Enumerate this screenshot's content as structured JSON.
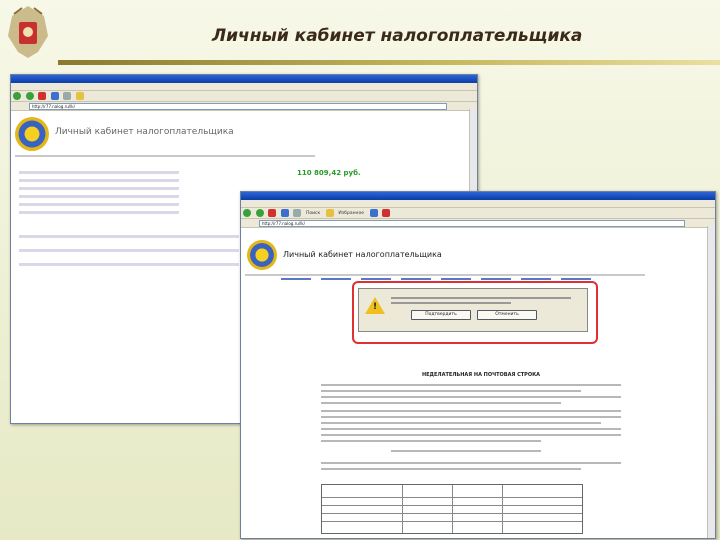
{
  "slide": {
    "title": "Личный кабинет налогоплательщика",
    "accent": "#3b2a1a"
  },
  "window_back": {
    "address": "http://r77.nalog.ru/lk/",
    "cabinet_title": "Личный кабинет налогоплательщика",
    "amount": "110 809,42 руб."
  },
  "window_front": {
    "address": "http://r77.nalog.ru/lk/",
    "cabinet_title": "Личный кабинет налогоплательщика",
    "toolbar": {
      "search_label": "Поиск",
      "favorites_label": "Избранное"
    },
    "document_heading": "НЕДЕЛАТЕЛЬНАЯ НА ПОЧТОВАЯ СТРОКА",
    "dialog": {
      "ok_label": "Подтвердить",
      "cancel_label": "Отменить"
    }
  },
  "colors": {
    "highlight": "#e03030",
    "title_bar": "#0a3ea8"
  }
}
